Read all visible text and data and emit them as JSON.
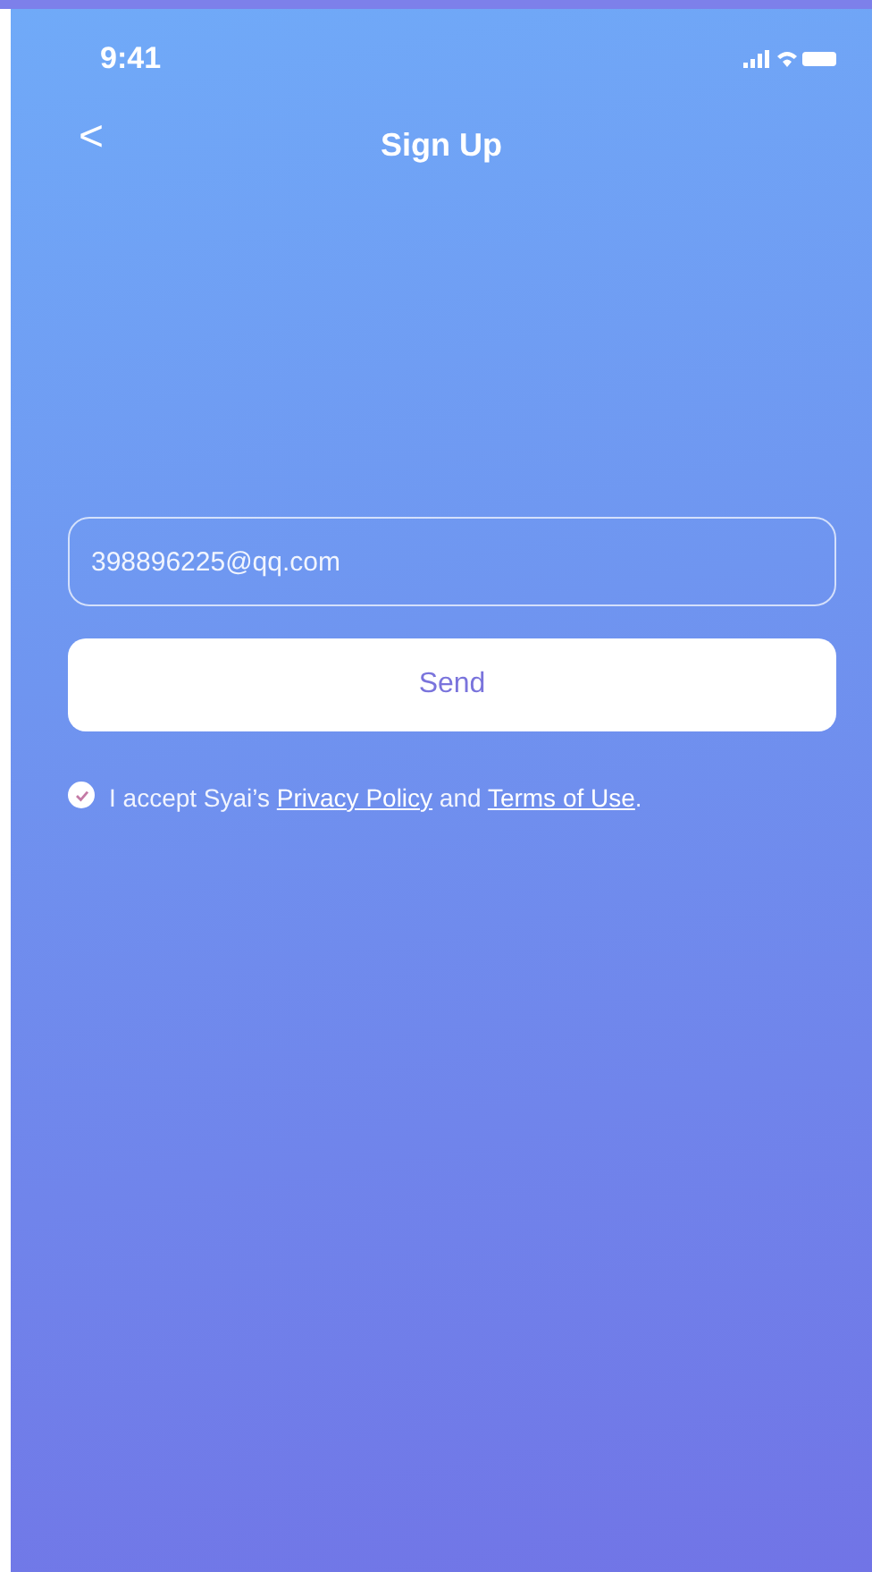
{
  "status_bar": {
    "time": "9:41"
  },
  "nav": {
    "back": "<",
    "title": "Sign Up"
  },
  "email_field": {
    "value": "398896225@qq.com"
  },
  "send_button": {
    "label": "Send"
  },
  "agreement": {
    "checked": true,
    "parts": [
      {
        "kind": "text",
        "text": "I accept Syai’s "
      },
      {
        "kind": "link",
        "text": "Privacy Policy"
      },
      {
        "kind": "text",
        "text": " and "
      },
      {
        "kind": "link",
        "text": "Terms of Use"
      },
      {
        "kind": "text",
        "text": "."
      }
    ]
  }
}
